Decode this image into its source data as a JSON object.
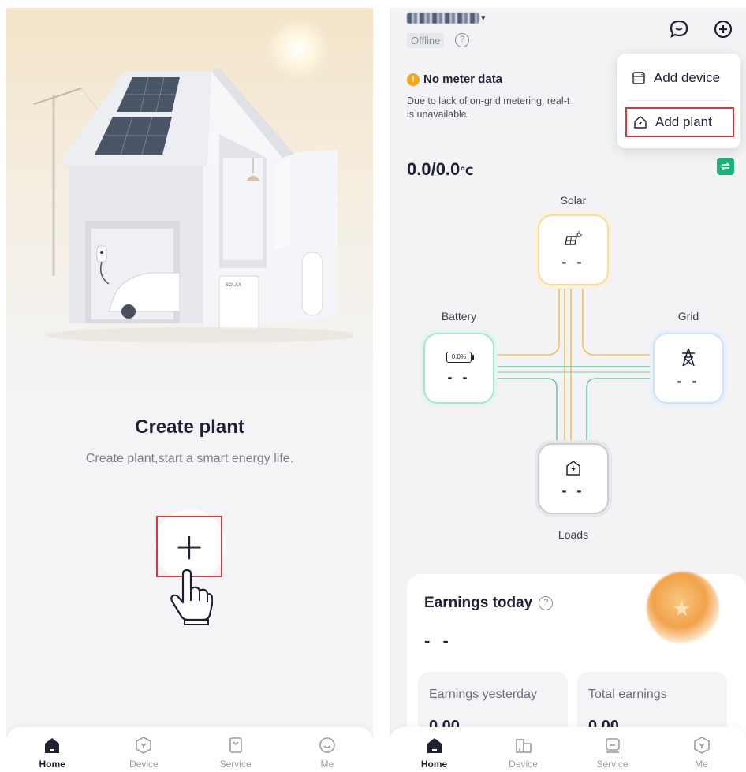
{
  "left": {
    "house_brand": "SOLAX",
    "battery_display": "",
    "create_title": "Create plant",
    "create_subtitle": "Create plant,start a smart energy life.",
    "plus_glyph": "+",
    "nav": [
      {
        "label": "Home",
        "icon": "home-icon",
        "active": true
      },
      {
        "label": "Device",
        "icon": "device-icon",
        "active": false
      },
      {
        "label": "Service",
        "icon": "service-icon",
        "active": false
      },
      {
        "label": "Me",
        "icon": "me-icon",
        "active": false
      }
    ]
  },
  "right": {
    "plant_caret": "▾",
    "status": "Offline",
    "help_glyph": "?",
    "meter_title": "No meter data",
    "meter_desc_line1": "Due to lack of on-grid metering, real-t",
    "meter_desc_line2": "is unavailable.",
    "popup": {
      "add_device": "Add device",
      "add_plant": "Add plant"
    },
    "temperature": "0.0/0.0",
    "temperature_unit": "℃",
    "nodes": {
      "solar": {
        "label": "Solar",
        "value": "- -"
      },
      "battery": {
        "label": "Battery",
        "value": "- -",
        "soc": "0.0%"
      },
      "grid": {
        "label": "Grid",
        "value": "- -"
      },
      "loads": {
        "label": "Loads",
        "value": "- -"
      }
    },
    "earnings": {
      "title": "Earnings today",
      "value": "- -",
      "yesterday_label": "Earnings yesterday",
      "yesterday_value": "0.00",
      "total_label": "Total earnings",
      "total_value": "0.00"
    },
    "nav": [
      {
        "label": "Home",
        "icon": "home-icon",
        "active": true
      },
      {
        "label": "Device",
        "icon": "device-icon",
        "active": false
      },
      {
        "label": "Service",
        "icon": "service-icon",
        "active": false
      },
      {
        "label": "Me",
        "icon": "me-icon",
        "active": false
      }
    ]
  },
  "colors": {
    "accent_red": "#d33a3a",
    "solar_line": "#f0c15c",
    "battery_line": "#6cc9a8",
    "switch_green": "#1fb07a",
    "warning": "#f5a623"
  }
}
